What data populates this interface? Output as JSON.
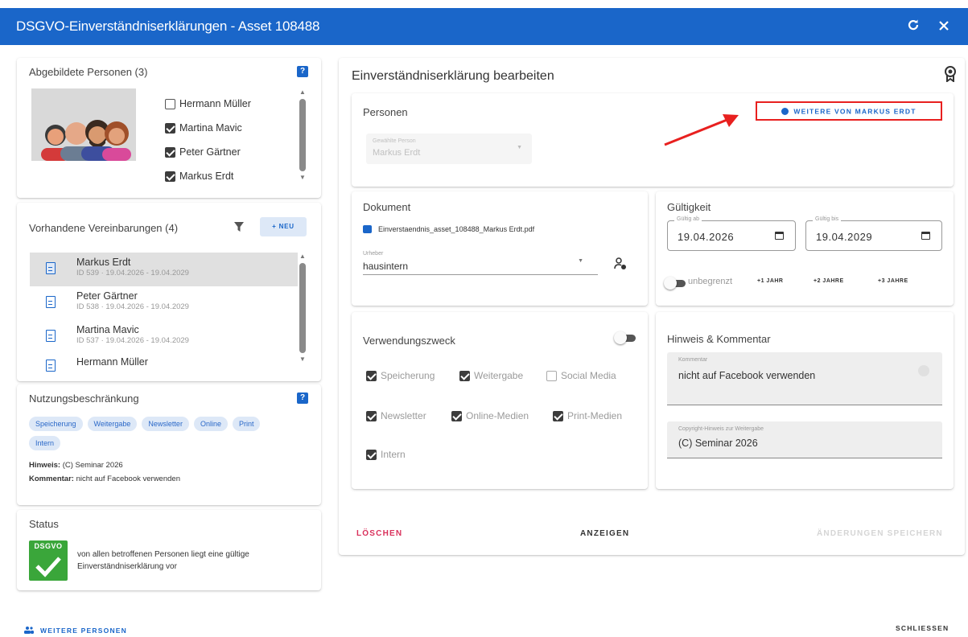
{
  "window": {
    "title": "DSGVO-Einverständniserklärungen - Asset 108488",
    "refresh_icon": "refresh-icon",
    "close_icon": "close-icon"
  },
  "persons_panel": {
    "title": "Abgebildete Personen (3)",
    "help": "?",
    "persons": [
      {
        "name": "Hermann Müller",
        "checked": false
      },
      {
        "name": "Martina Mavic",
        "checked": true
      },
      {
        "name": "Peter Gärtner",
        "checked": true
      },
      {
        "name": "Markus Erdt",
        "checked": true
      }
    ]
  },
  "agreements_panel": {
    "title": "Vorhandene Vereinbarungen (4)",
    "new_label": "+ NEU",
    "items": [
      {
        "name": "Markus Erdt",
        "sub": "ID 539 · 19.04.2026 - 19.04.2029",
        "selected": true
      },
      {
        "name": "Peter Gärtner",
        "sub": "ID 538 · 19.04.2026 - 19.04.2029",
        "selected": false
      },
      {
        "name": "Martina Mavic",
        "sub": "ID 537 · 19.04.2026 - 19.04.2029",
        "selected": false
      },
      {
        "name": "Hermann Müller",
        "sub": "",
        "selected": false
      }
    ]
  },
  "restriction_panel": {
    "title": "Nutzungsbeschränkung",
    "help": "?",
    "chips": [
      "Speicherung",
      "Weitergabe",
      "Newsletter",
      "Online",
      "Print",
      "Intern"
    ],
    "hint_label": "Hinweis:",
    "hint_value": " (C) Seminar 2026",
    "comment_label": "Kommentar:",
    "comment_value": " nicht auf Facebook verwenden"
  },
  "status_panel": {
    "title": "Status",
    "badge_text": "DSGVO",
    "message": "von allen betroffenen Personen liegt eine gültige Einverständniserklärung vor"
  },
  "editor": {
    "title": "Einverständniserklärung bearbeiten",
    "persons_section": {
      "title": "Personen",
      "more_button": "WEITERE VON MARKUS ERDT",
      "select_label": "Gewählte Person",
      "select_value": "Markus Erdt"
    },
    "document_section": {
      "title": "Dokument",
      "file_name": "Einverstaendnis_asset_108488_Markus Erdt.pdf",
      "select_label": "Urheber",
      "select_value": "hausintern"
    },
    "validity_section": {
      "title": "Gültigkeit",
      "from_label": "Gültig ab",
      "from_value": "19.04.2026",
      "to_label": "Gültig bis",
      "to_value": "19.04.2029",
      "unlimited_label": "unbegrenzt",
      "year_buttons": [
        "+1 JAHR",
        "+2 JAHRE",
        "+3 JAHRE"
      ]
    },
    "purpose_section": {
      "title": "Verwendungszweck",
      "options": [
        {
          "label": "Speicherung",
          "checked": true
        },
        {
          "label": "Weitergabe",
          "checked": true
        },
        {
          "label": "Social Media",
          "checked": false
        },
        {
          "label": "Newsletter",
          "checked": true
        },
        {
          "label": "Online-Medien",
          "checked": true
        },
        {
          "label": "Print-Medien",
          "checked": true
        },
        {
          "label": "Intern",
          "checked": true
        }
      ]
    },
    "notes_section": {
      "title": "Hinweis & Kommentar",
      "comment_label": "Kommentar",
      "comment_value": "nicht auf Facebook verwenden",
      "copyright_label": "Copyright-Hinweis zur Weitergabe",
      "copyright_value": "(C) Seminar 2026"
    },
    "actions": {
      "delete": "LÖSCHEN",
      "show": "ANZEIGEN",
      "save": "ÄNDERUNGEN SPEICHERN"
    }
  },
  "footer": {
    "more_persons": "WEITERE PERSONEN",
    "close": "SCHLIESSEN"
  },
  "colors": {
    "primary": "#1a66c9",
    "danger": "#d9305b",
    "annotation_red": "#e8201f",
    "status_green": "#3aa63a"
  }
}
